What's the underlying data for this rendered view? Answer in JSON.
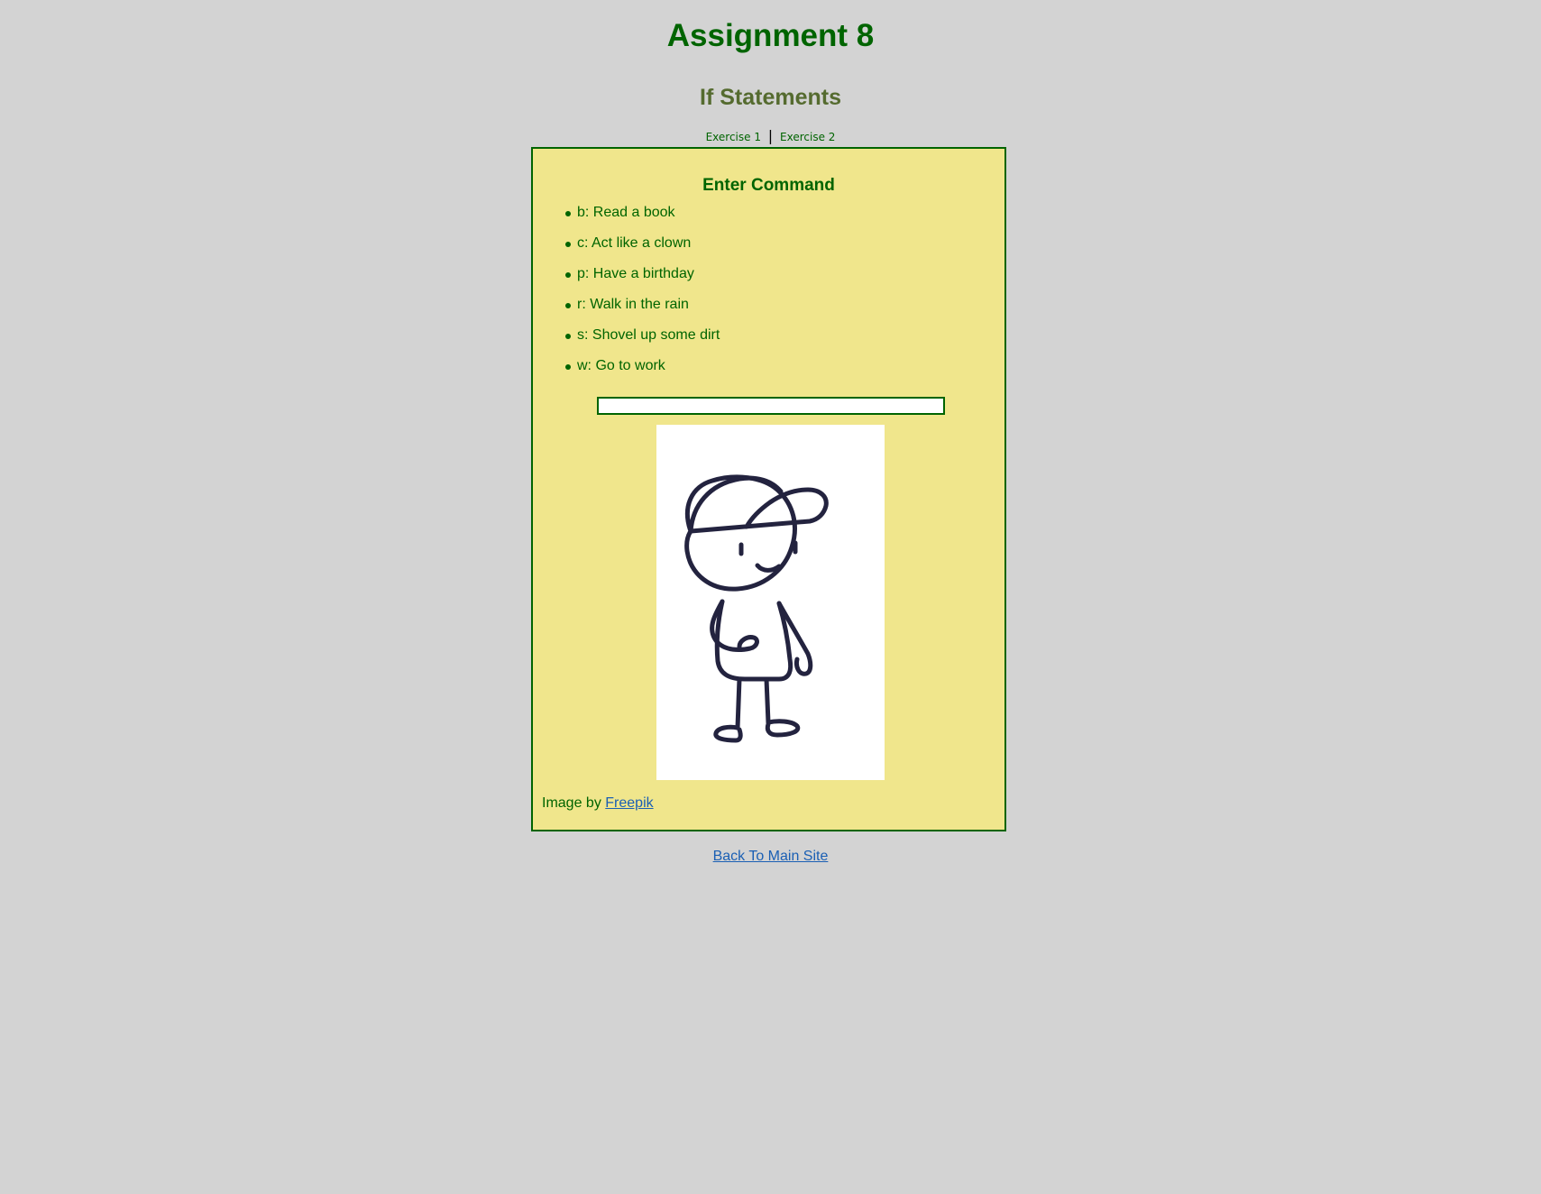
{
  "page": {
    "title": "Assignment 8",
    "subtitle": "If Statements"
  },
  "nav": {
    "exercise1": "Exercise 1",
    "separator": "|",
    "exercise2": "Exercise 2"
  },
  "panel": {
    "heading": "Enter Command",
    "commands": [
      {
        "label": "b: Read a book"
      },
      {
        "label": "c: Act like a clown"
      },
      {
        "label": "p: Have a birthday"
      },
      {
        "label": "r: Walk in the rain"
      },
      {
        "label": "s: Shovel up some dirt"
      },
      {
        "label": "w: Go to work"
      }
    ],
    "input": {
      "value": "",
      "placeholder": ""
    },
    "image": {
      "icon": "stick-figure-boy-with-cap"
    },
    "credit": {
      "prefix": "Image by",
      "link_text": "Freepik"
    }
  },
  "footer": {
    "back_link": "Back To Main Site"
  },
  "colors": {
    "background": "#d3d3d3",
    "panel_background": "#f0e68c",
    "primary_green": "#006400",
    "subtitle_olive": "#556b2f",
    "link_blue": "#1a5fb4",
    "figure_stroke": "#23233f"
  }
}
